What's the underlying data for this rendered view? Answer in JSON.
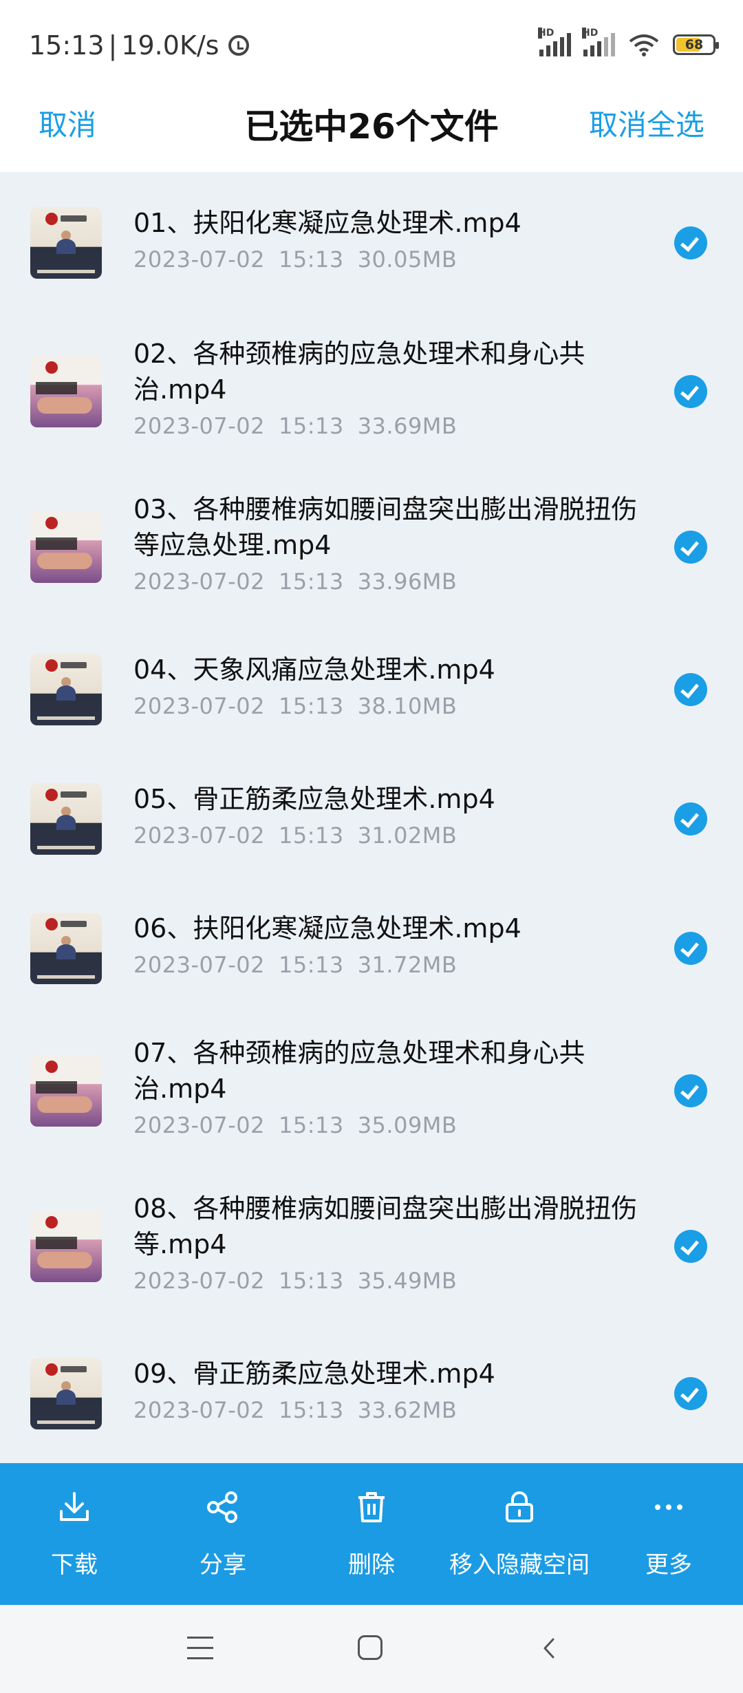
{
  "status": {
    "time": "15:13",
    "speed": "19.0K/s",
    "battery": "68",
    "network_label": "HD"
  },
  "titlebar": {
    "cancel": "取消",
    "title": "已选中26个文件",
    "deselect_all": "取消全选"
  },
  "files": [
    {
      "name": "01、扶阳化寒凝应急处理术.mp4",
      "date": "2023-07-02",
      "time": "15:13",
      "size": "30.05MB",
      "thumb": "classroom"
    },
    {
      "name": "02、各种颈椎病的应急处理术和身心共治.mp4",
      "date": "2023-07-02",
      "time": "15:13",
      "size": "33.69MB",
      "thumb": "treatment"
    },
    {
      "name": "03、各种腰椎病如腰间盘突出膨出滑脱扭伤等应急处理.mp4",
      "date": "2023-07-02",
      "time": "15:13",
      "size": "33.96MB",
      "thumb": "treatment"
    },
    {
      "name": "04、天象风痛应急处理术.mp4",
      "date": "2023-07-02",
      "time": "15:13",
      "size": "38.10MB",
      "thumb": "classroom"
    },
    {
      "name": "05、骨正筋柔应急处理术.mp4",
      "date": "2023-07-02",
      "time": "15:13",
      "size": "31.02MB",
      "thumb": "classroom"
    },
    {
      "name": "06、扶阳化寒凝应急处理术.mp4",
      "date": "2023-07-02",
      "time": "15:13",
      "size": "31.72MB",
      "thumb": "classroom"
    },
    {
      "name": "07、各种颈椎病的应急处理术和身心共治.mp4",
      "date": "2023-07-02",
      "time": "15:13",
      "size": "35.09MB",
      "thumb": "treatment"
    },
    {
      "name": "08、各种腰椎病如腰间盘突出膨出滑脱扭伤等.mp4",
      "date": "2023-07-02",
      "time": "15:13",
      "size": "35.49MB",
      "thumb": "treatment"
    },
    {
      "name": "09、骨正筋柔应急处理术.mp4",
      "date": "2023-07-02",
      "time": "15:13",
      "size": "33.62MB",
      "thumb": "classroom"
    }
  ],
  "actions": [
    {
      "label": "下载",
      "icon": "download-icon"
    },
    {
      "label": "分享",
      "icon": "share-icon"
    },
    {
      "label": "删除",
      "icon": "trash-icon"
    },
    {
      "label": "移入隐藏空间",
      "icon": "lock-icon"
    },
    {
      "label": "更多",
      "icon": "more-icon"
    }
  ],
  "colors": {
    "accent": "#1a9ee6",
    "action_bar": "#1b9be4",
    "list_bg": "#ecf1f6"
  }
}
